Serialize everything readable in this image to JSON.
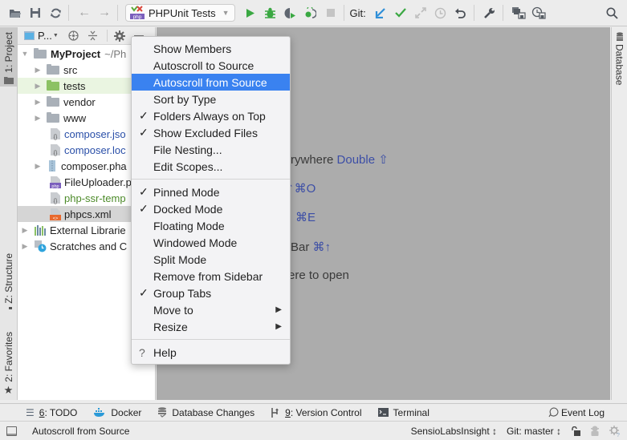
{
  "toolbar": {
    "run_config_label": "PHPUnit Tests",
    "git_label": "Git:",
    "icons": [
      "open-folder-icon",
      "save-icon",
      "sync-icon",
      "back-icon",
      "forward-icon",
      "run-icon",
      "debug-icon",
      "coverage-icon",
      "profile-icon",
      "stop-icon",
      "git-update-icon",
      "git-commit-icon",
      "git-compare-icon",
      "git-history-icon",
      "git-revert-icon",
      "settings-wrench-icon",
      "project-structure-icon",
      "sdk-icon",
      "search-icon"
    ],
    "colors": {
      "run": "#3aa842",
      "debug": "#3aa842",
      "git_update": "#2f8fd8",
      "git_commit": "#3aa842"
    }
  },
  "left_stripe": {
    "project": "1: Project",
    "structure": "Z: Structure",
    "favorites": "2: Favorites"
  },
  "right_stripe": {
    "database": "Database"
  },
  "project_panel": {
    "view_selector": "P...",
    "tree": [
      {
        "label": "MyProject",
        "suffix": "~/Ph",
        "type": "folder",
        "expanded": true,
        "level": 0,
        "bold": true
      },
      {
        "label": "src",
        "type": "folder",
        "level": 1
      },
      {
        "label": "tests",
        "type": "folder-green",
        "level": 1,
        "selected": true
      },
      {
        "label": "vendor",
        "type": "folder",
        "level": 1
      },
      {
        "label": "www",
        "type": "folder",
        "level": 1
      },
      {
        "label": "composer.json",
        "display": "composer.jso",
        "type": "json",
        "level": 1,
        "color": "#2a4fa8"
      },
      {
        "label": "composer.lock",
        "display": "composer.loc",
        "type": "json",
        "level": 1,
        "color": "#2a4fa8"
      },
      {
        "label": "composer.phar",
        "display": "composer.pha",
        "type": "archive",
        "level": 1
      },
      {
        "label": "FileUploader.php",
        "display": "FileUploader.p",
        "type": "php",
        "level": 1
      },
      {
        "label": "php-ssr-template",
        "display": "php-ssr-temp",
        "type": "json",
        "level": 1,
        "color": "#4d8b2a"
      },
      {
        "label": "phpcs.xml",
        "type": "xml",
        "level": 1,
        "highlighted": true
      },
      {
        "label": "External Libraries",
        "display": "External Librarie",
        "type": "libraries",
        "level": 0
      },
      {
        "label": "Scratches and Consoles",
        "display": "Scratches and C",
        "type": "scratches",
        "level": 0
      }
    ]
  },
  "editor_hints": {
    "search_everywhere_text": "rywhere",
    "search_everywhere_key": "Double ⇧",
    "goto_file_key": "⇧⌘O",
    "recent_key": "⌘E",
    "nav_bar_text": "Bar",
    "nav_bar_key": "⌘↑",
    "drop_text": "ere to open"
  },
  "context_menu": {
    "groups": [
      [
        {
          "label": "Show Members",
          "checked": false
        },
        {
          "label": "Autoscroll to Source",
          "checked": false
        },
        {
          "label": "Autoscroll from Source",
          "checked": false,
          "highlighted": true
        },
        {
          "label": "Sort by Type",
          "checked": false
        },
        {
          "label": "Folders Always on Top",
          "checked": true
        },
        {
          "label": "Show Excluded Files",
          "checked": true
        },
        {
          "label": "File Nesting...",
          "checked": false
        },
        {
          "label": "Edit Scopes...",
          "checked": false
        }
      ],
      [
        {
          "label": "Pinned Mode",
          "checked": true
        },
        {
          "label": "Docked Mode",
          "checked": true
        },
        {
          "label": "Floating Mode",
          "checked": false
        },
        {
          "label": "Windowed Mode",
          "checked": false
        },
        {
          "label": "Split Mode",
          "checked": false
        },
        {
          "label": "Remove from Sidebar",
          "checked": false
        },
        {
          "label": "Group Tabs",
          "checked": true
        },
        {
          "label": "Move to",
          "checked": false,
          "submenu": true
        },
        {
          "label": "Resize",
          "checked": false,
          "submenu": true
        }
      ],
      [
        {
          "label": "Help",
          "icon": "?"
        }
      ]
    ],
    "check_glyph": "✓",
    "submenu_glyph": "▶"
  },
  "bottom_bar": {
    "items": [
      {
        "label": "6: TODO",
        "mnemonic": "6",
        "rest": ": TODO",
        "icon": "todo-list-icon"
      },
      {
        "label": "Docker",
        "icon": "docker-icon"
      },
      {
        "label": "Database Changes",
        "icon": "database-changes-icon"
      },
      {
        "label": "9: Version Control",
        "mnemonic": "9",
        "rest": ": Version Control",
        "icon": "version-control-icon"
      },
      {
        "label": "Terminal",
        "icon": "terminal-icon"
      }
    ],
    "event_log": "Event Log"
  },
  "status_bar": {
    "message": "Autoscroll from Source",
    "insight": "SensioLabsInsight ↕",
    "git_branch": "Git: master ↕"
  }
}
